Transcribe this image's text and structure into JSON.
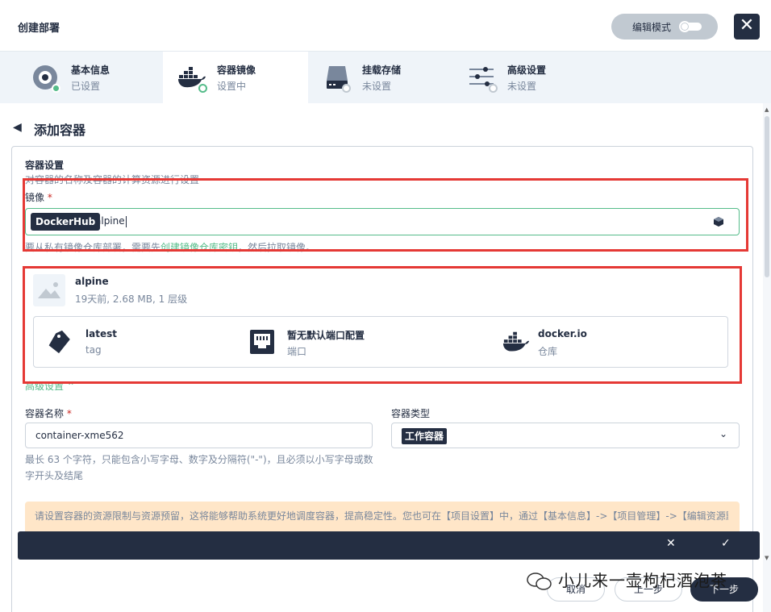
{
  "header": {
    "title": "创建部署",
    "edit_mode_label": "编辑模式",
    "close_glyph": "✕"
  },
  "steps": [
    {
      "title": "基本信息",
      "status": "已设置",
      "icon": "settings-disc-icon",
      "state": "done"
    },
    {
      "title": "容器镜像",
      "status": "设置中",
      "icon": "docker-whale-icon",
      "state": "active"
    },
    {
      "title": "挂载存储",
      "status": "未设置",
      "icon": "storage-icon",
      "state": "pending"
    },
    {
      "title": "高级设置",
      "status": "未设置",
      "icon": "sliders-icon",
      "state": "pending"
    }
  ],
  "page": {
    "back_title": "添加容器"
  },
  "container_settings": {
    "title": "容器设置",
    "description": "对容器的名称及容器的计算资源进行设置",
    "image_label": "镜像",
    "required_mark": "*",
    "registry_tag": "DockerHub",
    "image_value": "alpine",
    "hint_prefix": "要从私有镜像仓库部署，需要先",
    "hint_link": "创建镜像仓库密钥",
    "hint_suffix": "，然后拉取镜像。"
  },
  "image_result": {
    "name": "alpine",
    "meta": "19天前, 2.68 MB, 1 层级",
    "cards": [
      {
        "title": "latest",
        "sub": "tag",
        "icon": "tag-icon"
      },
      {
        "title": "暂无默认端口配置",
        "sub": "端口",
        "icon": "port-icon"
      },
      {
        "title": "docker.io",
        "sub": "仓库",
        "icon": "docker-whale-icon"
      }
    ]
  },
  "advanced_toggle": "高级设置",
  "form": {
    "name_label": "容器名称",
    "name_value": "container-xme562",
    "name_help_line1": "最长 63 个字符，只能包含小写字母、数字及分隔符(\"-\")，且必须以小写字母或数",
    "name_help_line2": "字开头及结尾",
    "type_label": "容器类型",
    "type_value": "工作容器"
  },
  "warning": {
    "text": "请设置容器的资源限制与资源预留，这将能够帮助系统更好地调度容器，提高稳定性。您也可在【项目设置】中，通过【基本信息】->【项目管理】->【编辑资源默"
  },
  "confirm_bar": {
    "cancel_glyph": "✕",
    "confirm_glyph": "✓"
  },
  "footer": {
    "cancel": "取消",
    "prev": "上一步",
    "next": "下一步"
  },
  "watermark": "小儿来一壶枸杞酒泡茶",
  "colors": {
    "accent": "#55bc8a",
    "dark": "#242e42",
    "highlight_border": "#e53935",
    "warning_bg": "#ffe6c8"
  }
}
